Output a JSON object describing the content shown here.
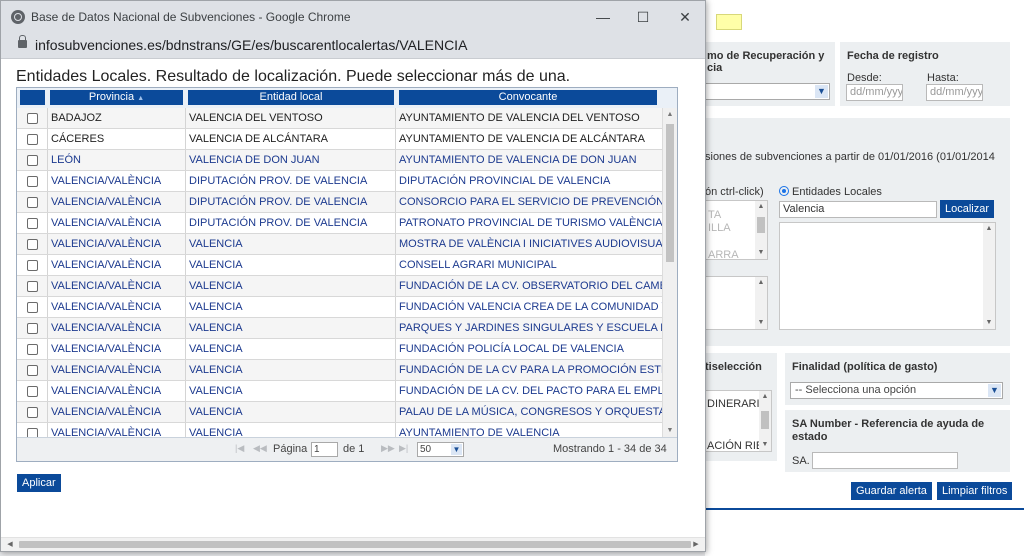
{
  "window": {
    "title": "Base de Datos Nacional de Subvenciones - Google Chrome",
    "url": "infosubvenciones.es/bdnstrans/GE/es/buscarentlocalertas/VALENCIA",
    "minimize": "—",
    "maximize": "☐",
    "close": "✕"
  },
  "popup": {
    "heading": "Entidades Locales. Resultado de localización. Puede seleccionar más de una.",
    "columns": {
      "provincia": "Provincia",
      "sort_icon": "▲",
      "entidad": "Entidad local",
      "convocante": "Convocante"
    },
    "rows": [
      {
        "style": "dark",
        "provincia": "BADAJOZ",
        "entidad": "VALENCIA DEL VENTOSO",
        "convocante": "AYUNTAMIENTO DE VALENCIA DEL VENTOSO"
      },
      {
        "style": "dark",
        "provincia": "CÁCERES",
        "entidad": "VALENCIA DE ALCÁNTARA",
        "convocante": "AYUNTAMIENTO DE VALENCIA DE ALCÁNTARA"
      },
      {
        "style": "blue",
        "provincia": "LEÓN",
        "entidad": "VALENCIA DE DON JUAN",
        "convocante": "AYUNTAMIENTO DE VALENCIA DE DON JUAN"
      },
      {
        "style": "blue",
        "provincia": "VALENCIA/VALÈNCIA",
        "entidad": "DIPUTACIÓN PROV. DE VALENCIA",
        "convocante": "DIPUTACIÓN PROVINCIAL DE VALENCIA"
      },
      {
        "style": "blue",
        "provincia": "VALENCIA/VALÈNCIA",
        "entidad": "DIPUTACIÓN PROV. DE VALENCIA",
        "convocante": "CONSORCIO PARA EL SERVICIO DE PREVENCIÓN Y"
      },
      {
        "style": "blue",
        "provincia": "VALENCIA/VALÈNCIA",
        "entidad": "DIPUTACIÓN PROV. DE VALENCIA",
        "convocante": "PATRONATO PROVINCIAL DE TURISMO  VALÈNCIA, T"
      },
      {
        "style": "blue",
        "provincia": "VALENCIA/VALÈNCIA",
        "entidad": "VALENCIA",
        "convocante": "MOSTRA DE VALÈNCIA I INICIATIVES AUDIOVISUALS"
      },
      {
        "style": "blue",
        "provincia": "VALENCIA/VALÈNCIA",
        "entidad": "VALENCIA",
        "convocante": "CONSELL AGRARI MUNICIPAL"
      },
      {
        "style": "blue",
        "provincia": "VALENCIA/VALÈNCIA",
        "entidad": "VALENCIA",
        "convocante": "FUNDACIÓN DE LA CV. OBSERVATORIO DEL CAMBIO"
      },
      {
        "style": "blue",
        "provincia": "VALENCIA/VALÈNCIA",
        "entidad": "VALENCIA",
        "convocante": "FUNDACIÓN VALENCIA CREA DE LA COMUNIDAD VA"
      },
      {
        "style": "blue",
        "provincia": "VALENCIA/VALÈNCIA",
        "entidad": "VALENCIA",
        "convocante": "PARQUES Y JARDINES SINGULARES Y ESCUELA MUN"
      },
      {
        "style": "blue",
        "provincia": "VALENCIA/VALÈNCIA",
        "entidad": "VALENCIA",
        "convocante": "FUNDACIÓN POLICÍA LOCAL DE VALENCIA"
      },
      {
        "style": "blue",
        "provincia": "VALENCIA/VALÈNCIA",
        "entidad": "VALENCIA",
        "convocante": "FUNDACIÓN DE LA CV PARA LA PROMOCIÓN ESTRAT"
      },
      {
        "style": "blue",
        "provincia": "VALENCIA/VALÈNCIA",
        "entidad": "VALENCIA",
        "convocante": "FUNDACIÓN DE LA CV. DEL PACTO PARA EL EMPLEO"
      },
      {
        "style": "blue",
        "provincia": "VALENCIA/VALÈNCIA",
        "entidad": "VALENCIA",
        "convocante": "PALAU DE LA MÚSICA, CONGRESOS Y ORQUESTA DE"
      },
      {
        "style": "blue",
        "provincia": "VALENCIA/VALÈNCIA",
        "entidad": "VALENCIA",
        "convocante": "AYUNTAMIENTO DE VALENCIA"
      }
    ],
    "pager": {
      "first": "|◀",
      "prev": "◀◀",
      "page_label": "Página",
      "page_value": "1",
      "of_label": "de 1",
      "next": "▶▶",
      "last": "▶|",
      "page_size": "50",
      "summary": "Mostrando 1 - 34 de 34"
    },
    "apply_button": "Aplicar"
  },
  "background": {
    "recovery_label": "mo de Recuperación y",
    "recovery_label2": "cia",
    "fecha_label": "Fecha de registro",
    "desde_label": "Desde:",
    "hasta_label": "Hasta:",
    "date_placeholder": "dd/mm/yyyy",
    "info_text": "siones de subvenciones a partir de 01/01/2016 (01/01/2014",
    "ctrl_click_text": "ón ctrl-click)",
    "entidades_radio": "Entidades Locales",
    "search_value": "Valencia",
    "localizar_button": "Localizar",
    "list_item_1": "TA",
    "list_item_2": "ILLA",
    "list_item_3": "ARRA",
    "multiselect_label": "tiselección",
    "multi_item_1": "DINERARI",
    "multi_item_2": "ACIÓN RIE",
    "finalidad_label": "Finalidad (política de gasto)",
    "finalidad_select": "-- Selecciona una opción",
    "sa_label": "SA Number - Referencia de ayuda de estado",
    "sa_prefix": "SA.",
    "guardar_button": "Guardar alerta",
    "limpiar_button": "Limpiar filtros"
  }
}
